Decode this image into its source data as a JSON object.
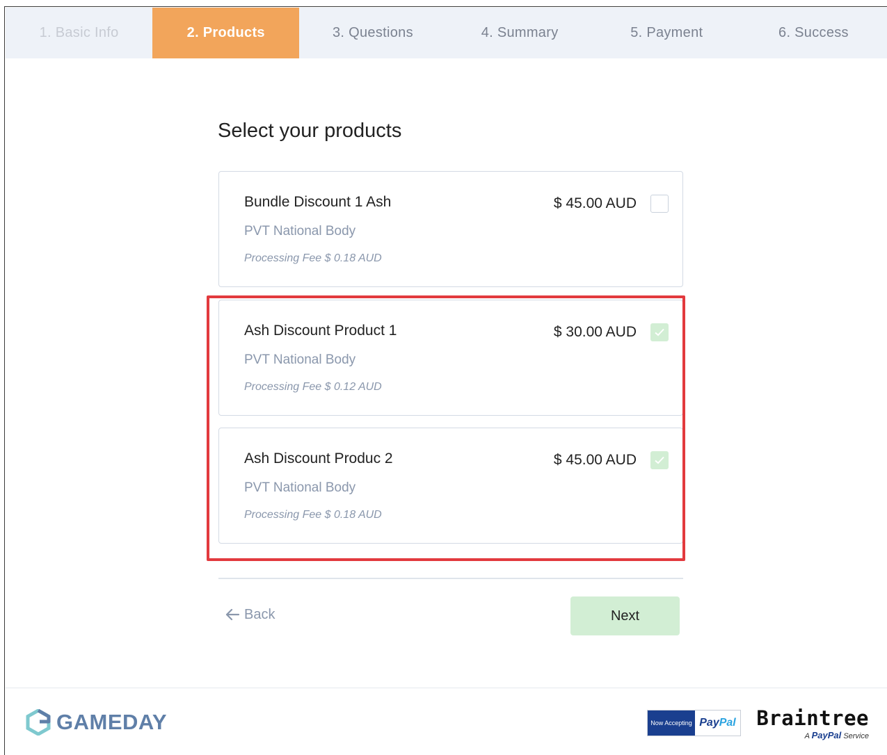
{
  "stepper": {
    "steps": [
      {
        "label": "1. Basic Info",
        "state": "done"
      },
      {
        "label": "2. Products",
        "state": "active"
      },
      {
        "label": "3. Questions",
        "state": "upcoming"
      },
      {
        "label": "4. Summary",
        "state": "upcoming"
      },
      {
        "label": "5. Payment",
        "state": "upcoming"
      },
      {
        "label": "6. Success",
        "state": "upcoming"
      }
    ]
  },
  "page": {
    "title": "Select your products"
  },
  "products": [
    {
      "name": "Bundle Discount 1 Ash",
      "org": "PVT National Body",
      "fee": "Processing Fee $ 0.18 AUD",
      "price": "$ 45.00 AUD",
      "checked": false
    },
    {
      "name": "Ash Discount Product 1",
      "org": "PVT National Body",
      "fee": "Processing Fee $ 0.12 AUD",
      "price": "$ 30.00 AUD",
      "checked": true
    },
    {
      "name": "Ash Discount Produc 2",
      "org": "PVT National Body",
      "fee": "Processing Fee $ 0.18 AUD",
      "price": "$ 45.00 AUD",
      "checked": true
    }
  ],
  "nav": {
    "back_label": "Back",
    "next_label": "Next"
  },
  "footer": {
    "brand": "GAMEDAY",
    "paypal_badge_left": "Now Accepting",
    "paypal_pay": "Pay",
    "paypal_pal": "Pal",
    "braintree": "Braintree",
    "braintree_sub_a": "A",
    "braintree_sub_paypal": "PayPal",
    "braintree_sub_service": "Service"
  },
  "colors": {
    "active_step": "#f2a55b",
    "highlight_border": "#e23a3e",
    "checked_fill": "#d2eed4",
    "next_button": "#d2eed4"
  }
}
